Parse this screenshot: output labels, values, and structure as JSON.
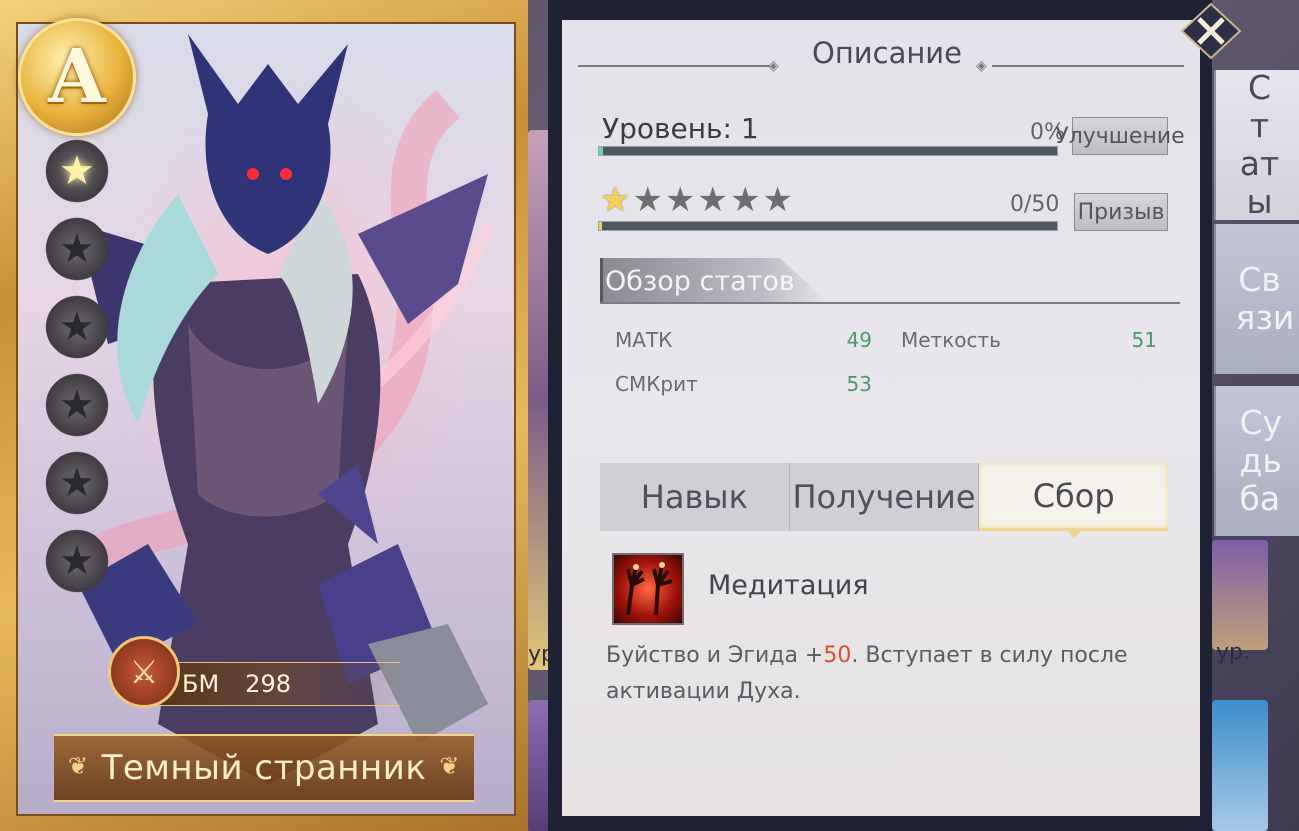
{
  "hero": {
    "rank": "A",
    "stars_total": 6,
    "stars_filled": 1,
    "power_label": "БМ",
    "power_value": "298",
    "name": "Темный странник"
  },
  "panel": {
    "title": "Описание",
    "level_label": "Уровень: 1",
    "level_percent_text": "0%",
    "level_progress": 0.0,
    "upgrade_button": "Улучшение",
    "star_rating": {
      "filled": 1,
      "total": 6
    },
    "shard_count": "0/50",
    "summon_button": "Призыв",
    "section_title": "Обзор статов",
    "stats": [
      {
        "name": "МАТК",
        "value": "49"
      },
      {
        "name": "Меткость",
        "value": "51"
      },
      {
        "name": "СМКрит",
        "value": "53"
      }
    ],
    "tabs": [
      "Навык",
      "Получение",
      "Сбор"
    ],
    "active_tab": "Сбор",
    "skill": {
      "name": "Медитация",
      "desc_before": "Буйство и Эгида +",
      "desc_value": "50",
      "desc_after": ". Вступает в силу после активации Духа."
    }
  },
  "side_tabs": [
    {
      "label": "Ст ат ы",
      "active": true
    },
    {
      "label": "Св язи",
      "active": false
    },
    {
      "label": "Су дь ба",
      "active": false
    }
  ],
  "background": {
    "left_level_text": "ур.",
    "right_level_text": "ур."
  },
  "colors": {
    "card_gold": "#d9a347",
    "progress_fill": "#6fd6a8",
    "stat_value": "#4a9a6a",
    "highlight": "#d8502a"
  },
  "icons": {
    "close": "close-x-icon",
    "power": "crossed-swords-icon",
    "star": "star-icon"
  }
}
